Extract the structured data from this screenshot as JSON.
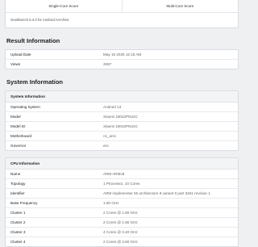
{
  "scores": {
    "single_core_label": "Single-Core Score",
    "multi_core_label": "Multi-Core Score",
    "version": "Geekbench 6.4.0 for Android AArch64"
  },
  "result_information": {
    "title": "Result Information",
    "rows": [
      {
        "key": "Upload Date",
        "value": "May 19 2025 12:15 AM"
      },
      {
        "key": "Views",
        "value": "2067"
      }
    ]
  },
  "system_information": {
    "title": "System Information",
    "panel_title": "System Information",
    "rows": [
      {
        "key": "Operating System",
        "value": "Android 13"
      },
      {
        "key": "Model",
        "value": "Xiaomi 23042PN24C"
      },
      {
        "key": "Model ID",
        "value": "Xiaomi 23042PN24C"
      },
      {
        "key": "Motherboard",
        "value": "c1_amc"
      },
      {
        "key": "Governor",
        "value": "ero"
      }
    ]
  },
  "cpu_information": {
    "panel_title": "CPU Information",
    "rows": [
      {
        "key": "Name",
        "value": "ARM ARMv8"
      },
      {
        "key": "Topology",
        "value": "1 Processor, 10 Cores"
      },
      {
        "key": "Identifier",
        "value": "ARM implementer 65 architecture 8 variant 0 part 3461 revision 1"
      },
      {
        "key": "Base Frequency",
        "value": "1.80 GHz"
      },
      {
        "key": "Cluster 1",
        "value": "2 Cores @ 1.80 GHz"
      },
      {
        "key": "Cluster 2",
        "value": "2 Cores @ 1.80 GHz"
      },
      {
        "key": "Cluster 3",
        "value": "4 Cores @ 3.40 GHz"
      },
      {
        "key": "Cluster 4",
        "value": "2 Cores @ 3.60 GHz"
      }
    ]
  }
}
